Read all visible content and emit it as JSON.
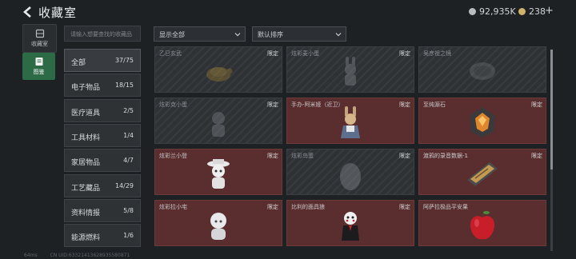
{
  "header": {
    "title": "收藏室",
    "currency_a": "92,935K",
    "currency_b": "238",
    "plus": "+"
  },
  "tabs": [
    {
      "label": "收藏室"
    },
    {
      "label": "图鉴"
    }
  ],
  "search": {
    "placeholder": "请输入想要查找的收藏品"
  },
  "filters": {
    "display": "显示全部",
    "sort": "默认排序"
  },
  "categories": [
    {
      "label": "全部",
      "count": "37/75"
    },
    {
      "label": "电子物品",
      "count": "18/15"
    },
    {
      "label": "医疗道具",
      "count": "2/5"
    },
    {
      "label": "工具材料",
      "count": "1/4"
    },
    {
      "label": "家居物品",
      "count": "4/7"
    },
    {
      "label": "工艺藏品",
      "count": "14/29"
    },
    {
      "label": "资料情报",
      "count": "5/8"
    },
    {
      "label": "能源燃料",
      "count": "1/6"
    }
  ],
  "items": [
    {
      "name": "乙巳玄武",
      "tag": "限定",
      "icon": "turtle-figurine",
      "owned": false
    },
    {
      "name": "炫彩麦小蛋",
      "tag": "限定",
      "icon": "rabbit-figure",
      "owned": false
    },
    {
      "name": "吴彦祖之镜",
      "tag": "",
      "icon": "mirror",
      "owned": false
    },
    {
      "name": "炫彩克小蛋",
      "tag": "限定",
      "icon": "small-figure",
      "owned": false
    },
    {
      "name": "手办-阿米娅（近卫）",
      "tag": "限定",
      "icon": "rabbit-girl-figure",
      "owned": true
    },
    {
      "name": "至纯源石",
      "tag": "限定",
      "icon": "orange-crystal",
      "owned": true
    },
    {
      "name": "炫彩兰小登",
      "tag": "限定",
      "icon": "hat-doll",
      "owned": true
    },
    {
      "name": "炫彩鸟蛋",
      "tag": "限定",
      "icon": "egg",
      "owned": false
    },
    {
      "name": "渡鸦的录音数据-1",
      "tag": "限定",
      "icon": "recorder-device",
      "owned": true
    },
    {
      "name": "炫彩拉小宅",
      "tag": "限定",
      "icon": "white-hair-doll",
      "owned": true
    },
    {
      "name": "比利的面具狼",
      "tag": "限定",
      "icon": "masked-puppet",
      "owned": true
    },
    {
      "name": "阿萨拉极品平安果",
      "tag": "",
      "icon": "red-apple",
      "owned": true
    }
  ],
  "status": {
    "ping": "64ms",
    "uid": "CN UID:63321413628935580871"
  }
}
